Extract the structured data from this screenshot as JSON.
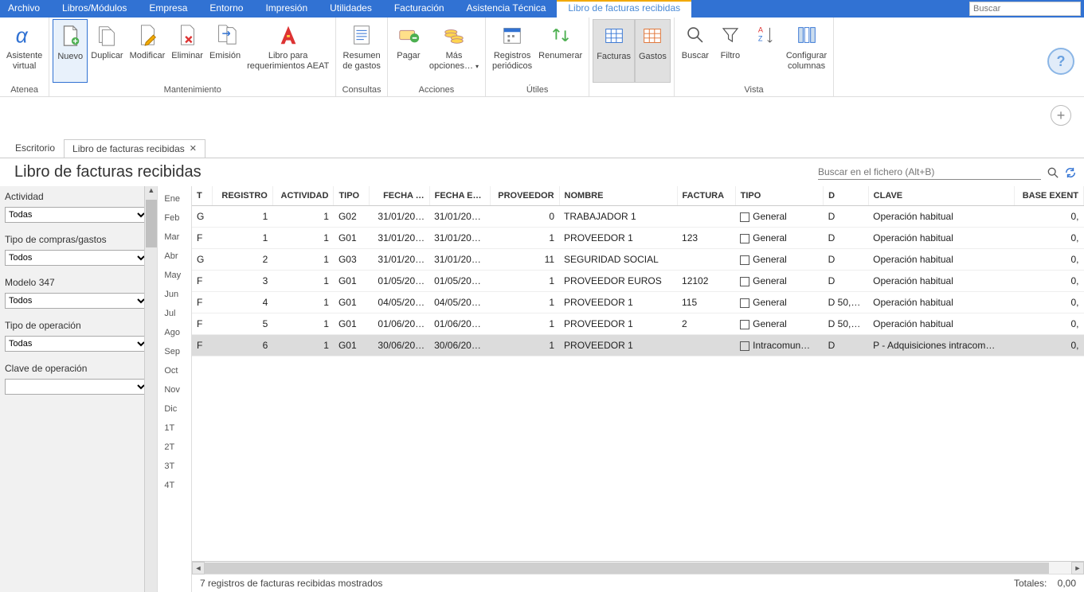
{
  "menubar": {
    "items": [
      "Archivo",
      "Libros/Módulos",
      "Empresa",
      "Entorno",
      "Impresión",
      "Utilidades",
      "Facturación",
      "Asistencia Técnica"
    ],
    "active_tab": "Libro de facturas recibidas",
    "search_placeholder": "Buscar"
  },
  "ribbon": {
    "groups": [
      {
        "label": "Atenea",
        "buttons": [
          {
            "name": "asistente-virtual",
            "label": "Asistente\nvirtual",
            "icon": "alpha"
          }
        ]
      },
      {
        "label": "Mantenimiento",
        "buttons": [
          {
            "name": "nuevo",
            "label": "Nuevo",
            "icon": "file-plus",
            "selected": true
          },
          {
            "name": "duplicar",
            "label": "Duplicar",
            "icon": "file-copy"
          },
          {
            "name": "modificar",
            "label": "Modificar",
            "icon": "file-edit"
          },
          {
            "name": "eliminar",
            "label": "Eliminar",
            "icon": "file-delete"
          },
          {
            "name": "emision",
            "label": "Emisión",
            "icon": "file-arrow"
          },
          {
            "name": "libro-aeat",
            "label": "Libro para\nrequerimientos AEAT",
            "icon": "aeat"
          }
        ]
      },
      {
        "label": "Consultas",
        "buttons": [
          {
            "name": "resumen-gastos",
            "label": "Resumen\nde gastos",
            "icon": "summary"
          }
        ]
      },
      {
        "label": "Acciones",
        "buttons": [
          {
            "name": "pagar",
            "label": "Pagar",
            "icon": "pay"
          },
          {
            "name": "mas-opciones",
            "label": "Más\nopciones…",
            "icon": "coins",
            "chev": true
          }
        ]
      },
      {
        "label": "Útiles",
        "buttons": [
          {
            "name": "reg-periodicos",
            "label": "Registros\nperiódicos",
            "icon": "calendar"
          },
          {
            "name": "renumerar",
            "label": "Renumerar",
            "icon": "arrows"
          }
        ]
      },
      {
        "label": "",
        "buttons": [
          {
            "name": "facturas",
            "label": "Facturas",
            "icon": "grid",
            "toggled": true
          },
          {
            "name": "gastos",
            "label": "Gastos",
            "icon": "grid2",
            "toggled": true
          }
        ]
      },
      {
        "label": "Vista",
        "buttons": [
          {
            "name": "buscar",
            "label": "Buscar",
            "icon": "search"
          },
          {
            "name": "filtro",
            "label": "Filtro",
            "icon": "funnel"
          },
          {
            "name": "sort",
            "label": "",
            "icon": "sort"
          },
          {
            "name": "config-col",
            "label": "Configurar\ncolumnas",
            "icon": "columns"
          }
        ]
      }
    ]
  },
  "tabs": {
    "items": [
      {
        "label": "Escritorio",
        "active": false,
        "closable": false
      },
      {
        "label": "Libro de facturas recibidas",
        "active": true,
        "closable": true
      }
    ]
  },
  "page": {
    "title": "Libro de facturas recibidas",
    "search_placeholder": "Buscar en el fichero (Alt+B)"
  },
  "filters": {
    "fields": [
      {
        "label": "Actividad",
        "value": "Todas"
      },
      {
        "label": "Tipo de compras/gastos",
        "value": "Todos"
      },
      {
        "label": "Modelo 347",
        "value": "Todos"
      },
      {
        "label": "Tipo de operación",
        "value": "Todas"
      },
      {
        "label": "Clave de operación",
        "value": ""
      }
    ]
  },
  "months": [
    "Ene",
    "Feb",
    "Mar",
    "Abr",
    "May",
    "Jun",
    "Jul",
    "Ago",
    "Sep",
    "Oct",
    "Nov",
    "Dic",
    "1T",
    "2T",
    "3T",
    "4T"
  ],
  "table": {
    "columns": [
      "T",
      "REGISTRO",
      "ACTIVIDAD",
      "TIPO",
      "FECHA …",
      "FECHA E…",
      "PROVEEDOR",
      "NOMBRE",
      "FACTURA",
      "TIPO",
      "D",
      "CLAVE",
      "BASE EXENT"
    ],
    "align": [
      "left",
      "right",
      "right",
      "left",
      "right",
      "left",
      "right",
      "left",
      "left",
      "left",
      "left",
      "left",
      "right"
    ],
    "rows": [
      {
        "t": "G",
        "reg": "1",
        "act": "1",
        "tipo": "G02",
        "f1": "31/01/20…",
        "f2": "31/01/20…",
        "prov": "0",
        "nombre": "TRABAJADOR 1",
        "fact": "",
        "tipo2": "General",
        "d": "D",
        "clave": "Operación habitual",
        "base": "0,"
      },
      {
        "t": "F",
        "reg": "1",
        "act": "1",
        "tipo": "G01",
        "f1": "31/01/20…",
        "f2": "31/01/20…",
        "prov": "1",
        "nombre": "PROVEEDOR 1",
        "fact": "123",
        "tipo2": "General",
        "d": "D",
        "clave": "Operación habitual",
        "base": "0,"
      },
      {
        "t": "G",
        "reg": "2",
        "act": "1",
        "tipo": "G03",
        "f1": "31/01/20…",
        "f2": "31/01/20…",
        "prov": "11",
        "nombre": "SEGURIDAD SOCIAL",
        "fact": "",
        "tipo2": "General",
        "d": "D",
        "clave": "Operación habitual",
        "base": "0,"
      },
      {
        "t": "F",
        "reg": "3",
        "act": "1",
        "tipo": "G01",
        "f1": "01/05/20…",
        "f2": "01/05/20…",
        "prov": "1",
        "nombre": "PROVEEDOR EUROS",
        "fact": "12102",
        "tipo2": "General",
        "d": "D",
        "clave": "Operación habitual",
        "base": "0,"
      },
      {
        "t": "F",
        "reg": "4",
        "act": "1",
        "tipo": "G01",
        "f1": "04/05/20…",
        "f2": "04/05/20…",
        "prov": "1",
        "nombre": "PROVEEDOR 1",
        "fact": "115",
        "tipo2": "General",
        "d": "D 50,…",
        "clave": "Operación habitual",
        "base": "0,"
      },
      {
        "t": "F",
        "reg": "5",
        "act": "1",
        "tipo": "G01",
        "f1": "01/06/20…",
        "f2": "01/06/20…",
        "prov": "1",
        "nombre": "PROVEEDOR 1",
        "fact": "2",
        "tipo2": "General",
        "d": "D 50,…",
        "clave": "Operación habitual",
        "base": "0,"
      },
      {
        "t": "F",
        "reg": "6",
        "act": "1",
        "tipo": "G01",
        "f1": "30/06/20…",
        "f2": "30/06/20…",
        "prov": "1",
        "nombre": "PROVEEDOR 1",
        "fact": "",
        "tipo2": "Intracomun…",
        "d": "D",
        "clave": "P - Adquisiciones intracom…",
        "base": "0,",
        "selected": true
      }
    ]
  },
  "footer": {
    "status": "7 registros de facturas recibidas mostrados",
    "totals_label": "Totales:",
    "totals_value": "0,00"
  }
}
